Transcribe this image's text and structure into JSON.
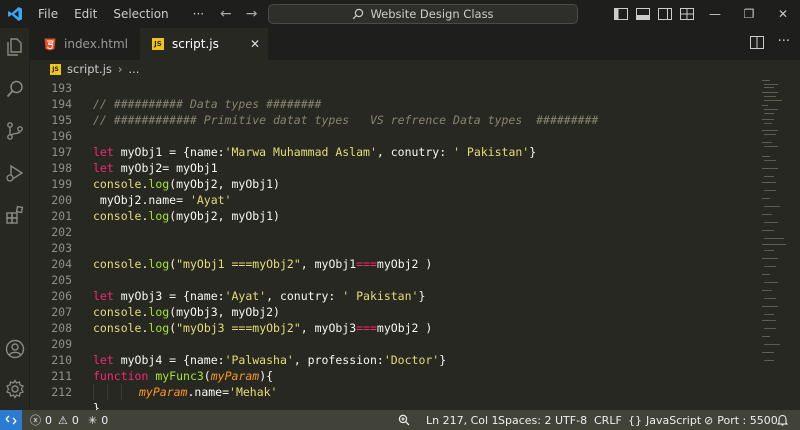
{
  "titlebar": {
    "menu": [
      "File",
      "Edit",
      "Selection",
      "···"
    ],
    "search_label": "Website Design Class"
  },
  "tabs": [
    {
      "label": "index.html",
      "icon": "html5-icon"
    },
    {
      "label": "script.js",
      "icon": "js-icon",
      "active": true
    }
  ],
  "breadcrumb": {
    "file": "script.js",
    "rest": "..."
  },
  "editor": {
    "lines": [
      {
        "n": "193"
      },
      {
        "n": "194"
      },
      {
        "n": "195"
      },
      {
        "n": "196"
      },
      {
        "n": "197"
      },
      {
        "n": "198"
      },
      {
        "n": "199"
      },
      {
        "n": "200"
      },
      {
        "n": "201"
      },
      {
        "n": "202"
      },
      {
        "n": "203"
      },
      {
        "n": "204"
      },
      {
        "n": "205"
      },
      {
        "n": "206"
      },
      {
        "n": "207"
      },
      {
        "n": "208"
      },
      {
        "n": "209"
      },
      {
        "n": "210"
      },
      {
        "n": "211"
      },
      {
        "n": "212"
      }
    ],
    "code": {
      "l194": "// ########## Data types ########",
      "l195": "// ############ Primitive datat types   VS refrence Data types  #########",
      "l197": [
        "let",
        " myObj1 = {name:",
        "'Marwa Muhammad Aslam'",
        ", conutry: ",
        "' Pakistan'",
        "}"
      ],
      "l198": [
        "let",
        " myObj2= myObj1"
      ],
      "l199": [
        "console",
        ".",
        "log",
        "(myObj2, myObj1)"
      ],
      "l200": [
        " myObj2.name= ",
        "'Ayat'"
      ],
      "l201": [
        "console",
        ".",
        "log",
        "(myObj2, myObj1)"
      ],
      "l204": [
        "console",
        ".",
        "log",
        "(",
        "\"myObj1 ===myObj2\"",
        ", myObj1",
        "===",
        "myObj2 )"
      ],
      "l206": [
        "let",
        " myObj3 = {name:",
        "'Ayat'",
        ", conutry: ",
        "' Pakistan'",
        "}"
      ],
      "l207": [
        "console",
        ".",
        "log",
        "(myObj3, myObj2)"
      ],
      "l208": [
        "console",
        ".",
        "log",
        "(",
        "\"myObj3 ===myObj2\"",
        ", myObj3",
        "===",
        "myObj2 )"
      ],
      "l210": [
        "let",
        " myObj4 = {name:",
        "'Palwasha'",
        ", profession:",
        "'Doctor'",
        "}"
      ],
      "l211": [
        "function",
        " ",
        "myFunc3",
        "(",
        "myParam",
        "){"
      ],
      "l212": [
        "myParam",
        ".name=",
        "'Mehak'"
      ],
      "l213": "}"
    }
  },
  "statusbar": {
    "errors": "0",
    "warnings": "0",
    "ports": "0",
    "position": "Ln 217, Col 1",
    "spaces": "Spaces: 2",
    "encoding": "UTF-8",
    "eol": "CRLF",
    "language": "JavaScript",
    "port": "Port : 5500"
  },
  "colors": {
    "background": "#272822",
    "keyword": "#f92672",
    "function": "#a6e22e",
    "string": "#e6db74",
    "comment": "#88846f",
    "parameter": "#fd971f",
    "statusbar": "#414339",
    "remote": "#2b7bd0"
  }
}
